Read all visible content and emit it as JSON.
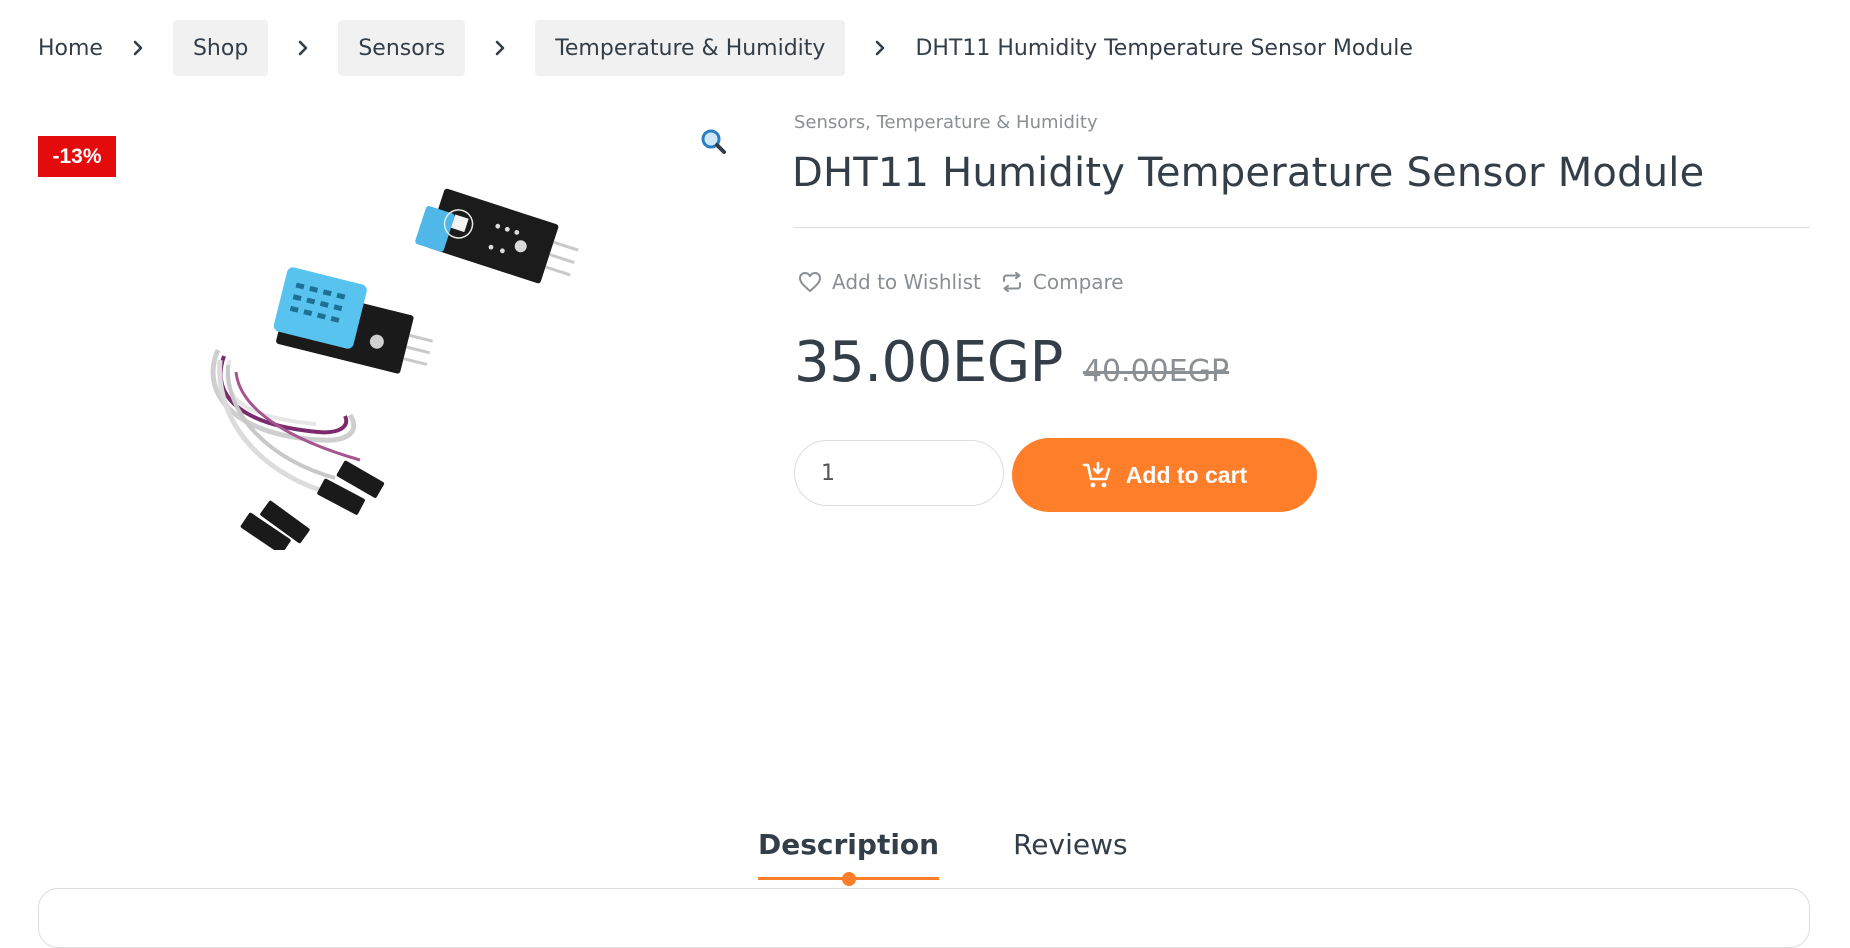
{
  "breadcrumb": {
    "home": "Home",
    "shop": "Shop",
    "sensors": "Sensors",
    "subcategory": "Temperature & Humidity",
    "current": "DHT11 Humidity Temperature Sensor Module"
  },
  "product": {
    "sale_badge": "-13%",
    "categories": [
      "Sensors",
      "Temperature & Humidity"
    ],
    "category_separator": ", ",
    "title": "DHT11 Humidity Temperature Sensor Module",
    "wishlist_label": "Add to Wishlist",
    "compare_label": "Compare",
    "price_current": "35.00EGP",
    "price_original": "40.00EGP",
    "quantity": "1",
    "add_to_cart_label": "Add to cart",
    "image_icon": "dht11-sensor-module-photo"
  },
  "tabs": [
    {
      "label": "Description",
      "active": true
    },
    {
      "label": "Reviews",
      "active": false
    }
  ],
  "colors": {
    "accent": "#fe7e29",
    "sale_badge": "#e30b0b",
    "text": "#333e48",
    "muted": "#8a8f94"
  }
}
